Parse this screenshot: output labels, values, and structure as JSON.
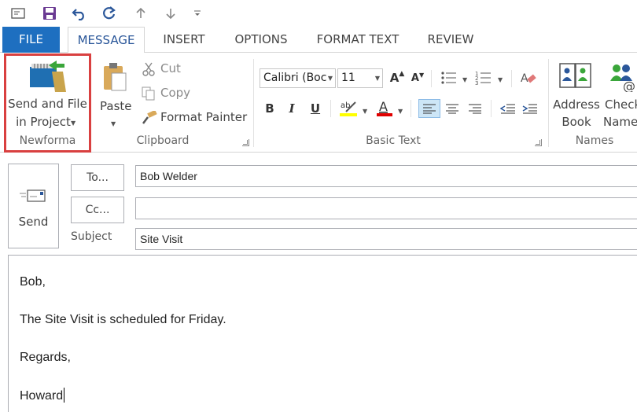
{
  "quick_access": {
    "icons": [
      "mail-icon",
      "save-icon",
      "undo-icon",
      "redo-icon",
      "up-arrow-icon",
      "down-arrow-icon",
      "customize-icon"
    ]
  },
  "tabs": [
    {
      "label": "FILE"
    },
    {
      "label": "MESSAGE"
    },
    {
      "label": "INSERT"
    },
    {
      "label": "OPTIONS"
    },
    {
      "label": "FORMAT TEXT"
    },
    {
      "label": "REVIEW"
    }
  ],
  "ribbon": {
    "newforma": {
      "button_line1": "Send and File",
      "button_line2": "in Project",
      "group_label": "Newforma",
      "highlight_color": "#d94040"
    },
    "clipboard": {
      "paste_label": "Paste",
      "cut_label": "Cut",
      "copy_label": "Copy",
      "format_painter_label": "Format Painter",
      "group_label": "Clipboard"
    },
    "basic_text": {
      "font_name": "Calibri (Boc",
      "font_size": "11",
      "bold": "B",
      "italic": "I",
      "underline": "U",
      "group_label": "Basic Text",
      "highlight_color": "#ffff00",
      "font_color": "#e00000"
    },
    "names": {
      "address_book_line1": "Address",
      "address_book_line2": "Book",
      "check_names_line1": "Check",
      "check_names_line2": "Names",
      "group_label": "Names"
    }
  },
  "compose": {
    "send_label": "Send",
    "to_button": "To...",
    "cc_button": "Cc...",
    "subject_label": "Subject",
    "to_value": "Bob Welder",
    "cc_value": "",
    "subject_value": "Site  Visit"
  },
  "body": {
    "lines": [
      "Bob,",
      "The Site Visit is scheduled for Friday.",
      "Regards,",
      "Howard"
    ]
  }
}
